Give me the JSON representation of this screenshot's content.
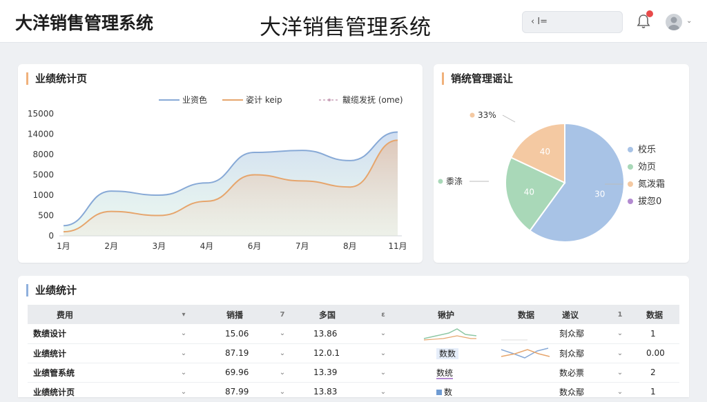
{
  "header": {
    "brand": "大洋销售管理系统",
    "center_title": "大洋销售管理系统",
    "search_text": "‹ I="
  },
  "line_card": {
    "title": "业绩统计页",
    "legend": [
      "业资色",
      "姿计 keip",
      "黻缆发抚 (ome)"
    ]
  },
  "pie_card": {
    "title": "销统管理谣让",
    "legend": [
      "校乐",
      "効页",
      "氮泼霜",
      "拔忽0"
    ]
  },
  "table_card": {
    "title": "业绩统计",
    "columns": [
      "费用",
      "销播",
      "多国",
      "锹护",
      "数据",
      "递议",
      "数据"
    ],
    "col_arrows": [
      "▾",
      "7",
      "ɛ",
      "1"
    ],
    "rows": [
      {
        "name": "数绩设计",
        "a": "15.06",
        "b": "13.86",
        "tag1": "",
        "tag2": "刻众鄢",
        "num": "1"
      },
      {
        "name": "业绩统计",
        "a": "87.19",
        "b": "12.0.1",
        "tag1": "数数",
        "tag2": "刻众鄢",
        "num": "0.00"
      },
      {
        "name": "业绩管系统",
        "a": "69.96",
        "b": "13.39",
        "tag1": "数统",
        "tag2": "数必票",
        "num": "2"
      },
      {
        "name": "业绩统计页",
        "a": "87.99",
        "b": "13.83",
        "tag1": "数",
        "tag2": "数众鄢",
        "num": "1"
      }
    ]
  },
  "chart_data": [
    {
      "type": "area",
      "title": "业绩统计页",
      "categories": [
        "1月",
        "2月",
        "3月",
        "4月",
        "6月",
        "7月",
        "8月",
        "11月"
      ],
      "y_ticks": [
        "0",
        "500",
        "1000",
        "5000",
        "8000",
        "14000",
        "15000"
      ],
      "series": [
        {
          "name": "业资色",
          "color": "#87a9d6",
          "values": [
            0.5,
            2.2,
            2.0,
            2.6,
            4.1,
            4.2,
            3.7,
            5.1
          ]
        },
        {
          "name": "姿计 keip",
          "color": "#e6a56c",
          "values": [
            0.2,
            1.2,
            1.0,
            1.7,
            3.0,
            2.7,
            2.4,
            4.7
          ]
        }
      ],
      "legend_extra": "黻缆发抚 (ome)",
      "legend_position": "top",
      "grid": false
    },
    {
      "type": "pie",
      "title": "销统管理谣让",
      "slices": [
        {
          "label": "30",
          "value": 60,
          "color": "#a8c3e6"
        },
        {
          "label": "40",
          "value": 22,
          "color": "#a9d8b8"
        },
        {
          "label": "40",
          "value": 18,
          "color": "#f4c9a2"
        }
      ],
      "outer_labels": [
        "33%",
        "黍涤"
      ],
      "legend": [
        {
          "name": "校乐",
          "color": "#a8c3e6"
        },
        {
          "name": "効页",
          "color": "#a9d8b8"
        },
        {
          "name": "氮泼霜",
          "color": "#f4c9a2"
        },
        {
          "name": "拔忽0",
          "color": "#b28ad0"
        }
      ],
      "legend_position": "right"
    }
  ]
}
